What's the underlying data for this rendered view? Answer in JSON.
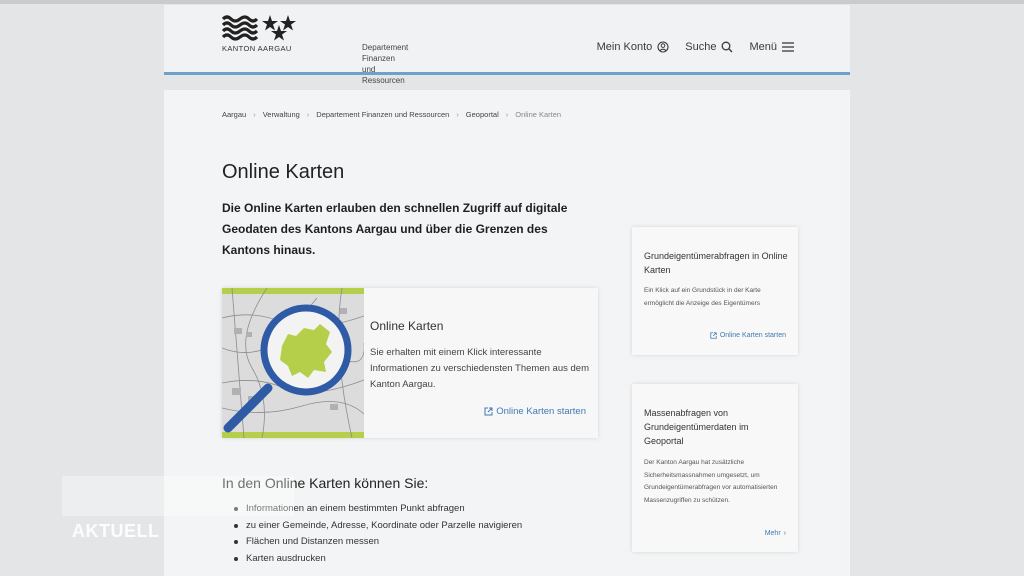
{
  "header": {
    "logo_text": "KANTON AARGAU",
    "department_line1": "Departement",
    "department_line2": "Finanzen und Ressourcen",
    "nav": {
      "account": "Mein Konto",
      "search": "Suche",
      "menu": "Menü"
    }
  },
  "breadcrumb": [
    "Aargau",
    "Verwaltung",
    "Departement Finanzen und Ressourcen",
    "Geoportal",
    "Online Karten"
  ],
  "page_title": "Online Karten",
  "intro": "Die Online Karten erlauben den schnellen Zugriff auf digitale Geodaten des Kantons Aargau und über die Grenzen des Kantons hinaus.",
  "feature": {
    "title": "Online Karten",
    "text": "Sie erhalten mit einem Klick interessante Informationen zu verschiedensten Themen aus dem Kanton Aargau.",
    "link": "Online Karten starten"
  },
  "list": {
    "title": "In den Online Karten können Sie:",
    "items": [
      "Informationen an einem bestimmten Punkt abfragen",
      "zu einer Gemeinde, Adresse, Koordinate oder Parzelle navigieren",
      "Flächen und Distanzen messen",
      "Karten ausdrucken"
    ]
  },
  "side_cards": [
    {
      "title": "Grundeigentümerabfragen in Online Karten",
      "text": "Ein Klick auf ein Grundstück in der Karte ermöglicht die Anzeige des Eigentümers",
      "link": "Online Karten starten"
    },
    {
      "title": "Massenabfragen von Grundeigentümerdaten im Geoportal",
      "text": "Der Kanton Aargau hat zusätzliche Sicherheitsmassnahmen umgesetzt, um Grundeigentümerabfragen vor automatisierten Massenzugriffen zu schützen.",
      "link": "Mehr"
    }
  ],
  "overlay": {
    "label": "AKTUELL"
  },
  "colors": {
    "accent_blue": "#3f79b3",
    "header_line": "#6fa0cc",
    "map_green": "#b5cf4a"
  }
}
